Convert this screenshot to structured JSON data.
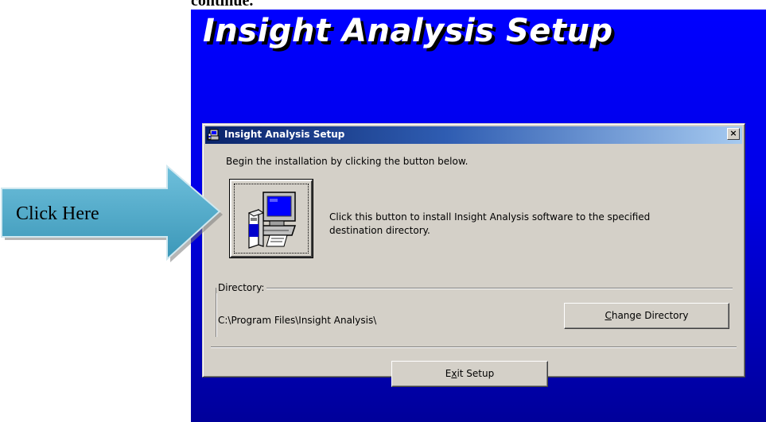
{
  "page": {
    "top_cut_text": "continue."
  },
  "banner": {
    "title": "Insight Analysis Setup"
  },
  "dialog": {
    "title": "Insight Analysis Setup",
    "close_label": "×",
    "instruction": "Begin the installation by clicking the button below.",
    "install_description": "Click this button to install Insight Analysis software to the specified destination directory.",
    "directory": {
      "label": "Directory:",
      "path": "C:\\Program Files\\Insight Analysis\\",
      "change_button": {
        "prefix": "",
        "accel": "C",
        "suffix": "hange Directory"
      }
    },
    "exit_button": {
      "prefix": "E",
      "accel": "x",
      "suffix": "it Setup"
    }
  },
  "callout": {
    "label": "Click Here"
  },
  "colors": {
    "desktop_blue": "#0000ff",
    "titlebar_start": "#0a246a",
    "titlebar_end": "#a6caf0",
    "dialog_face": "#d4d0c8",
    "arrow_fill": "#4aa6c6"
  }
}
